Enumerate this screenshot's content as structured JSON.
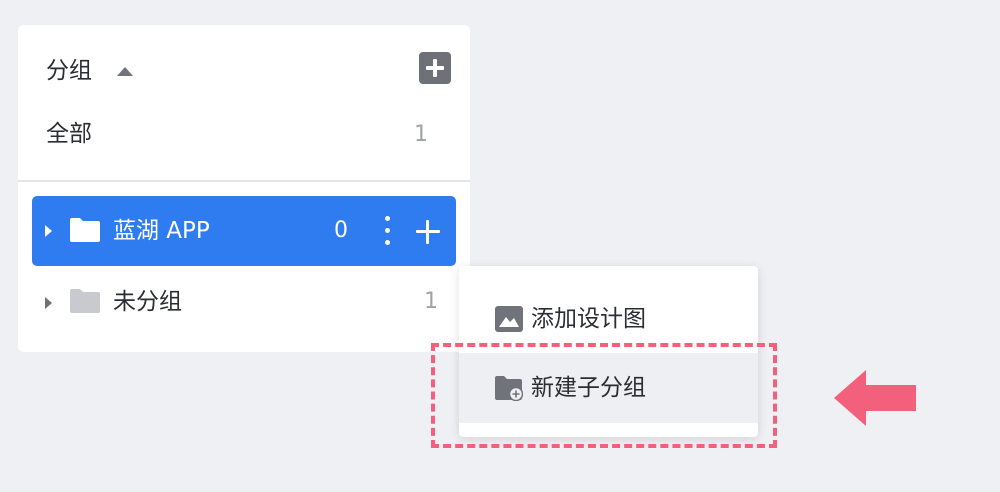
{
  "panel": {
    "header_title": "分组",
    "all_label": "全部",
    "all_count": "1"
  },
  "groups": [
    {
      "label": "蓝湖 APP",
      "count": "0",
      "selected": true
    },
    {
      "label": "未分组",
      "count": "1",
      "selected": false
    }
  ],
  "context_menu": {
    "items": [
      {
        "label": "添加设计图",
        "icon": "image-icon"
      },
      {
        "label": "新建子分组",
        "icon": "folder-add-icon",
        "highlighted": true
      }
    ]
  },
  "colors": {
    "accent": "#2f7bf0",
    "highlight_border": "#f2607c",
    "background": "#eff0f4"
  }
}
